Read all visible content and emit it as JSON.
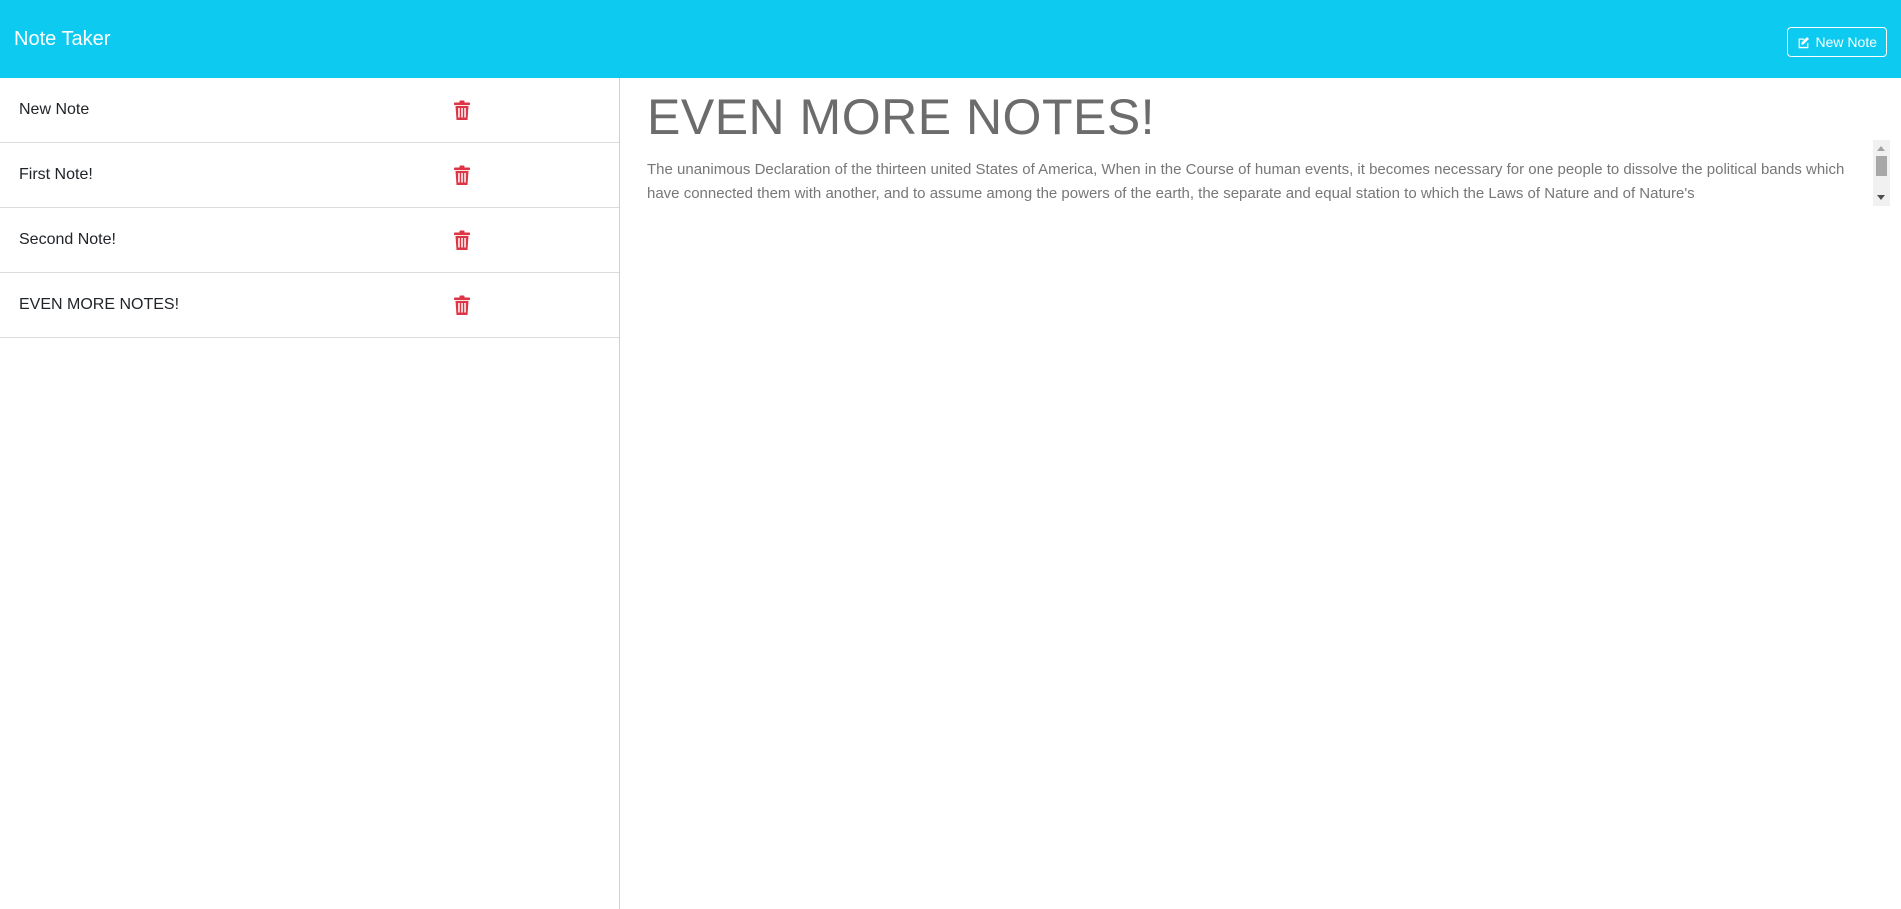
{
  "navbar": {
    "brand": "Note Taker",
    "new_note_label": "New Note",
    "background_color": "#0dcaf0"
  },
  "sidebar": {
    "notes": [
      {
        "title": "New Note",
        "delete_icon": "trash-icon"
      },
      {
        "title": "First Note!",
        "delete_icon": "trash-icon"
      },
      {
        "title": "Second Note!",
        "delete_icon": "trash-icon"
      },
      {
        "title": "EVEN MORE NOTES!",
        "delete_icon": "trash-icon"
      }
    ],
    "delete_icon_color": "#dc3545"
  },
  "editor": {
    "title": "EVEN MORE NOTES!",
    "body": "The unanimous Declaration of the thirteen united States of America, When in the Course of human events, it becomes necessary for one people to dissolve the political bands which have connected them with another, and to assume among the powers of the earth, the separate and equal station to which the Laws of Nature and of Nature's"
  }
}
